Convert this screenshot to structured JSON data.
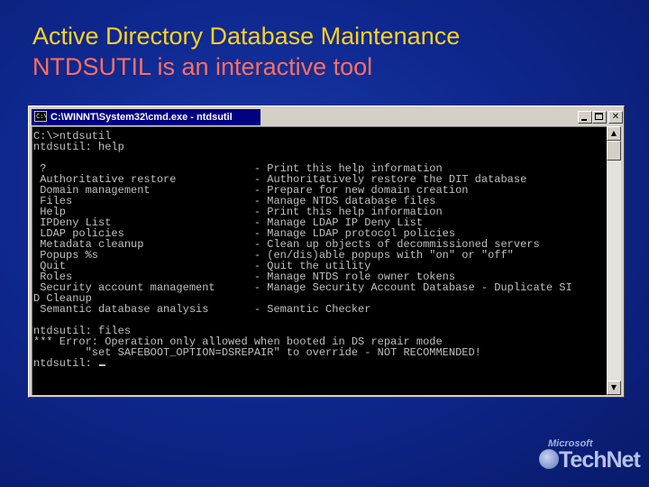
{
  "slide": {
    "title": "Active Directory Database Maintenance",
    "subtitle": "NTDSUTIL is an interactive tool"
  },
  "window": {
    "title": "C:\\WINNT\\System32\\cmd.exe - ntdsutil",
    "icon_label": "C:\\",
    "icon_name": "console-app-icon",
    "minimize_icon": "minimize-icon",
    "maximize_icon": "maximize-icon",
    "close_label": "✕"
  },
  "console": {
    "lines": [
      "C:\\>ntdsutil",
      "ntdsutil: help",
      "",
      " ?                                - Print this help information",
      " Authoritative restore            - Authoritatively restore the DIT database",
      " Domain management                - Prepare for new domain creation",
      " Files                            - Manage NTDS database files",
      " Help                             - Print this help information",
      " IPDeny List                      - Manage LDAP IP Deny List",
      " LDAP policies                    - Manage LDAP protocol policies",
      " Metadata cleanup                 - Clean up objects of decommissioned servers",
      " Popups %s                        - (en/dis)able popups with \"on\" or \"off\"",
      " Quit                             - Quit the utility",
      " Roles                            - Manage NTDS role owner tokens",
      " Security account management      - Manage Security Account Database - Duplicate SI",
      "D Cleanup",
      " Semantic database analysis       - Semantic Checker",
      "",
      "ntdsutil: files",
      "*** Error: Operation only allowed when booted in DS repair mode",
      "        \"set SAFEBOOT_OPTION=DSREPAIR\" to override - NOT RECOMMENDED!",
      "ntdsutil: "
    ]
  },
  "scrollbar": {
    "up_label": "▲",
    "down_label": "▼"
  },
  "logo": {
    "microsoft": "Microsoft",
    "technet": "TechNet"
  },
  "colors": {
    "title": "#ffd21e",
    "subtitle": "#ff6f5f",
    "background": "#0f2890",
    "console_bg": "#000000",
    "console_text": "#c0c0c0",
    "titlebar": "#000080"
  }
}
